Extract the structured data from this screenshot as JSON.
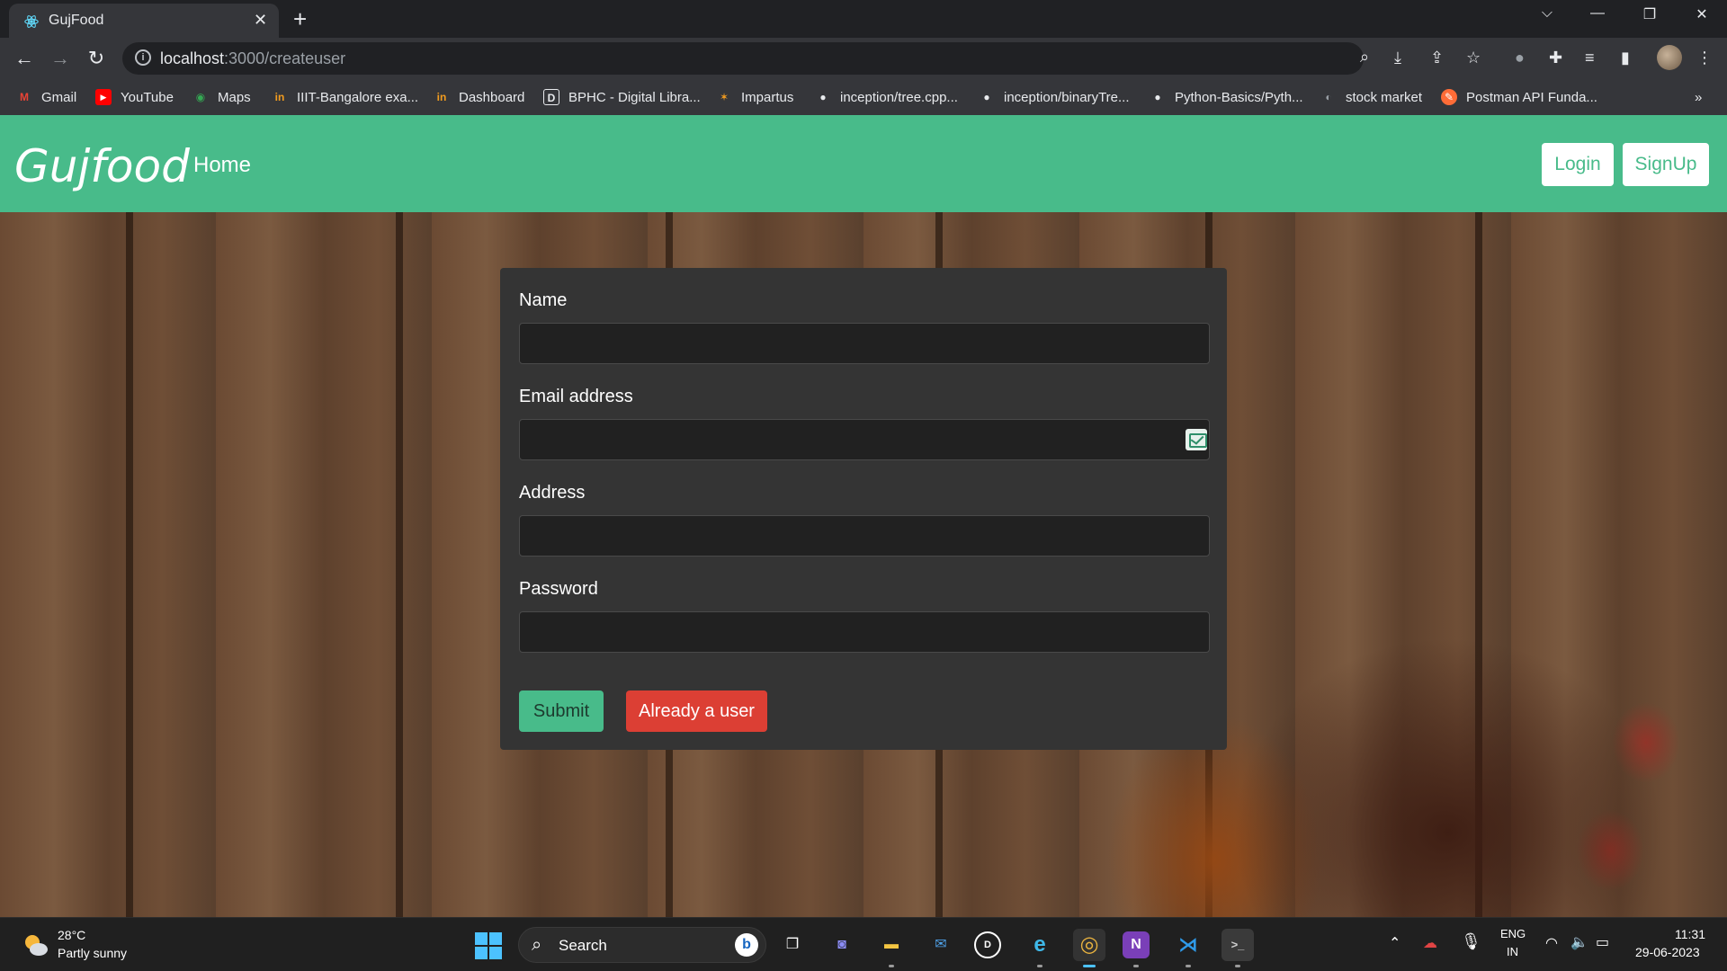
{
  "browser": {
    "tab_title": "GujFood",
    "tab_close": "✕",
    "new_tab": "+",
    "url_host": "localhost",
    "url_path": ":3000/createuser",
    "window_controls": [
      "⌵",
      "—",
      "❐",
      "✕"
    ],
    "nav": {
      "back": "←",
      "forward": "→",
      "reload": "↻"
    },
    "bookmarks": [
      {
        "label": "Gmail",
        "icon": "gmail-icon",
        "icon_glyph": "M",
        "color": "#ea4335"
      },
      {
        "label": "YouTube",
        "icon": "youtube-icon",
        "icon_glyph": "▶",
        "color": "#ff0000"
      },
      {
        "label": "Maps",
        "icon": "maps-icon",
        "icon_glyph": "◉",
        "color": "#34a853"
      },
      {
        "label": "IIIT-Bangalore exa...",
        "icon": "iiitb-icon",
        "icon_glyph": "in",
        "color": "#f29c1f"
      },
      {
        "label": "Dashboard",
        "icon": "iiitb-icon",
        "icon_glyph": "in",
        "color": "#f29c1f"
      },
      {
        "label": "BPHC - Digital Libra...",
        "icon": "library-icon",
        "icon_glyph": "D",
        "color": "#e8eaed"
      },
      {
        "label": "Impartus",
        "icon": "impartus-icon",
        "icon_glyph": "✶",
        "color": "#f29c1f"
      },
      {
        "label": "inception/tree.cpp...",
        "icon": "github-icon",
        "icon_glyph": "●",
        "color": "#e8eaed"
      },
      {
        "label": "inception/binaryTre...",
        "icon": "github-icon",
        "icon_glyph": "●",
        "color": "#e8eaed"
      },
      {
        "label": "Python-Basics/Pyth...",
        "icon": "github-icon",
        "icon_glyph": "●",
        "color": "#e8eaed"
      },
      {
        "label": "stock market",
        "icon": "globe-icon",
        "icon_glyph": "◐",
        "color": "#9aa0a6"
      },
      {
        "label": "Postman API Funda...",
        "icon": "postman-icon",
        "icon_glyph": "✎",
        "color": "#ff6c37"
      }
    ],
    "bookmarks_overflow": "»"
  },
  "app": {
    "brand": "Gujfood",
    "nav_home": "Home",
    "login": "Login",
    "signup": "SignUp",
    "accent_color": "#48bb8a",
    "danger_color": "#dc3f34"
  },
  "form": {
    "name_label": "Name",
    "name_value": "",
    "email_label": "Email address",
    "email_value": "",
    "address_label": "Address",
    "address_value": "",
    "password_label": "Password",
    "password_value": "",
    "submit": "Submit",
    "already_user": "Already a user"
  },
  "taskbar": {
    "temperature": "28°C",
    "condition": "Partly sunny",
    "search_label": "Search",
    "bing": "b",
    "apps": [
      {
        "name": "task-view-icon",
        "glyph": "❐"
      },
      {
        "name": "teams-chat-icon",
        "glyph": "◙"
      },
      {
        "name": "file-explorer-icon",
        "glyph": "▬"
      },
      {
        "name": "mail-icon",
        "glyph": "✉"
      },
      {
        "name": "dell-icon",
        "glyph": "D"
      },
      {
        "name": "edge-icon",
        "glyph": "e"
      },
      {
        "name": "chrome-icon",
        "glyph": "◎"
      },
      {
        "name": "onenote-icon",
        "glyph": "N"
      },
      {
        "name": "vscode-icon",
        "glyph": "⋊"
      },
      {
        "name": "terminal-icon",
        "glyph": ">_"
      }
    ],
    "language_top": "ENG",
    "language_bottom": "IN",
    "time": "11:31",
    "date": "29-06-2023"
  }
}
